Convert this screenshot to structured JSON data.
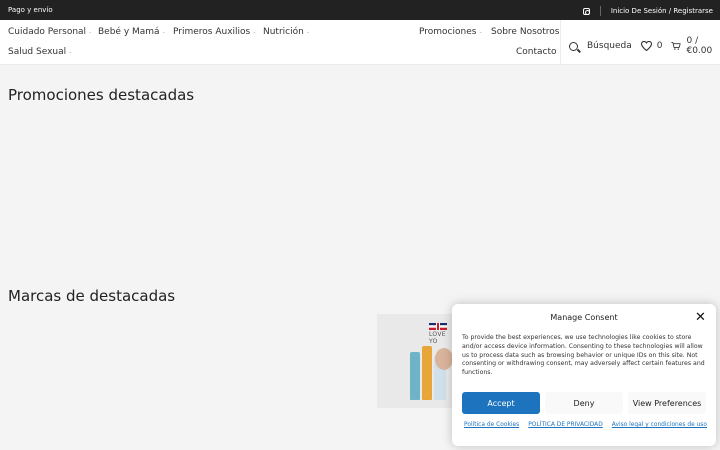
{
  "topbar": {
    "left_link": "Pago y envío",
    "icon": "instagram-icon",
    "account_link": "Inicio De Sesión / Registrarse"
  },
  "nav": {
    "items": [
      {
        "label": "Cuidado Personal",
        "has_dropdown": true
      },
      {
        "label": "Bebé y Mamá",
        "has_dropdown": true
      },
      {
        "label": "Primeros Auxilios",
        "has_dropdown": true
      },
      {
        "label": "Nutrición",
        "has_dropdown": true
      },
      {
        "label": "Salud Sexual",
        "has_dropdown": true
      }
    ],
    "right_items": [
      {
        "label": "Promociones",
        "has_dropdown": true
      },
      {
        "label": "Sobre Nosotros",
        "has_dropdown": false
      },
      {
        "label": "Contacto",
        "has_dropdown": false
      }
    ],
    "dropdown_glyph": "⌄"
  },
  "tools": {
    "search_label": "Búsqueda",
    "wishlist_count": "0",
    "cart_label": "0 / €0.00"
  },
  "sections": {
    "promos_title": "Promociones destacadas",
    "brands_title": "Marcas de destacadas"
  },
  "brand_banner": {
    "text": "LOVE YO"
  },
  "consent": {
    "title": "Manage Consent",
    "close": "✕",
    "body": "To provide the best experiences, we use technologies like cookies to store and/or access device information. Consenting to these technologies will allow us to process data such as browsing behavior or unique IDs on this site. Not consenting or withdrawing consent, may adversely affect certain features and functions.",
    "accept": "Accept",
    "deny": "Deny",
    "preferences": "View Preferences",
    "links": [
      "Política de Cookies",
      "POLÍTICA DE PRIVACIDAD",
      "Aviso legal y condiciones de uso"
    ]
  },
  "colors": {
    "topbar_bg": "#222222",
    "accent": "#1e73be",
    "page_bg": "#f4f4f4"
  }
}
